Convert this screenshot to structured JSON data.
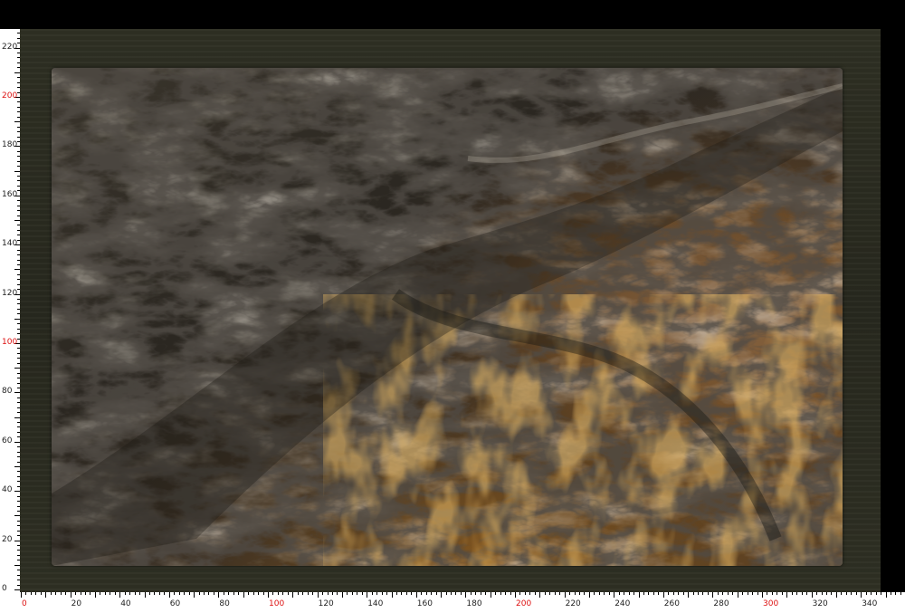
{
  "ruler": {
    "left_labels": [
      "220",
      "200",
      "180",
      "160",
      "140",
      "120",
      "100",
      "80",
      "60",
      "40",
      "20",
      "0"
    ],
    "left_highlight": [
      "200",
      "100"
    ],
    "bottom_labels": [
      "0",
      "20",
      "40",
      "60",
      "80",
      "100",
      "120",
      "140",
      "160",
      "180",
      "200",
      "220",
      "240",
      "260",
      "280",
      "300",
      "320",
      "340"
    ],
    "bottom_highlight": [
      "0",
      "100",
      "200",
      "300"
    ]
  },
  "colors": {
    "ruler_text": "#222222",
    "ruler_highlight": "#dd1111",
    "background": "#2f3024",
    "stone_dark": "#2a2620",
    "stone_brown": "#6b4a22",
    "stone_rust": "#a8691d"
  }
}
